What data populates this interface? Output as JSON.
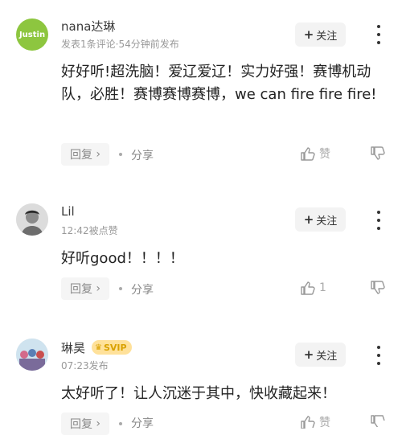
{
  "comments": [
    {
      "user": "nana达琳",
      "avatar_text": "Justin",
      "meta": "发表1条评论·54分钟前发布",
      "follow_label": "关注",
      "text": "好好听!超洗脑！爱辽爱辽！实力好强！赛博机动队，必胜！赛博赛博赛博，we can fire fire  fire!",
      "reply_label": "回复",
      "share_label": "分享",
      "like_label": "赞",
      "dislike_label": ""
    },
    {
      "user": "Lil",
      "meta": "12:42被点赞",
      "follow_label": "关注",
      "text": "好听good！！！！",
      "reply_label": "回复",
      "share_label": "分享",
      "like_count": "1"
    },
    {
      "user": "琳昊",
      "vip_label": "SVIP",
      "meta": "07:23发布",
      "follow_label": "关注",
      "text": "太好听了！让人沉迷于其中，快收藏起来！",
      "reply_label": "回复",
      "share_label": "分享",
      "like_label": "赞"
    }
  ],
  "colors": {
    "vip_bg": "#ffe19a",
    "vip_fg": "#d9a100",
    "avatar1": "#8dc63f"
  }
}
